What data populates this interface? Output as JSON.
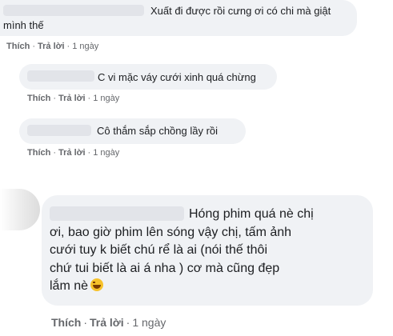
{
  "comments": [
    {
      "text_lines": [
        "Xuất đi được rồi cưng ơi có chi mà giật",
        "mình thế"
      ],
      "actions": {
        "like": "Thích",
        "reply": "Trả lời",
        "time": "1 ngày"
      }
    },
    {
      "text_lines": [
        "C vi mặc váy cưới xinh quá chừng"
      ],
      "actions": {
        "like": "Thích",
        "reply": "Trả lời",
        "time": "1 ngày"
      }
    },
    {
      "text_lines": [
        "Cô thắm sắp chồng lầy rồi"
      ],
      "actions": {
        "like": "Thích",
        "reply": "Trả lời",
        "time": "1 ngày"
      }
    }
  ],
  "main_comment": {
    "text_lines": [
      "Hóng phim quá nè chị",
      "ơi, bao giờ phim lên sóng vậy chị, tấm ảnh",
      "cưới tuy k biết chú rể là ai (nói thế thôi",
      "chứ tui biết là ai á nha ) cơ mà cũng đẹp",
      "lắm nè"
    ],
    "emoji": "laughing-emoji",
    "actions": {
      "like": "Thích",
      "reply": "Trả lời",
      "time": "1 ngày"
    }
  },
  "separator": "·"
}
